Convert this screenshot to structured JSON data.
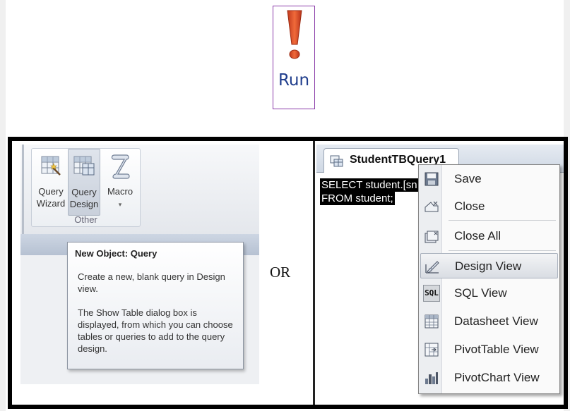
{
  "run_button": {
    "label": "Run",
    "icon": "exclamation-icon"
  },
  "ribbon": {
    "buttons": [
      {
        "label_line1": "Query",
        "label_line2": "Wizard",
        "icon": "query-wizard-icon"
      },
      {
        "label_line1": "Query",
        "label_line2": "Design",
        "icon": "query-design-icon"
      },
      {
        "label_line1": "Macro",
        "label_line2": "▾",
        "icon": "macro-scroll-icon"
      }
    ],
    "group_label": "Other"
  },
  "tooltip": {
    "title": "New Object: Query",
    "paragraph1": "Create a new, blank query in Design view.",
    "paragraph2": "The Show Table dialog box is displayed, from which you can choose tables or queries to add to the query design."
  },
  "or_label": "OR",
  "sql_pane": {
    "tab_label": "StudentTBQuery1",
    "lines": [
      "SELECT student.[sn",
      "FROM student;"
    ]
  },
  "context_menu": {
    "items": [
      {
        "label": "Save",
        "icon": "save-icon"
      },
      {
        "label": "Close",
        "icon": "close-icon"
      },
      {
        "label": "Close All",
        "icon": "close-all-icon"
      },
      {
        "label": "Design View",
        "icon": "design-view-icon",
        "highlighted": true
      },
      {
        "label": "SQL View",
        "icon": "sql-view-icon",
        "icon_text": "SQL"
      },
      {
        "label": "Datasheet View",
        "icon": "datasheet-view-icon"
      },
      {
        "label": "PivotTable View",
        "icon": "pivottable-view-icon"
      },
      {
        "label": "PivotChart View",
        "icon": "pivotchart-view-icon"
      }
    ]
  }
}
